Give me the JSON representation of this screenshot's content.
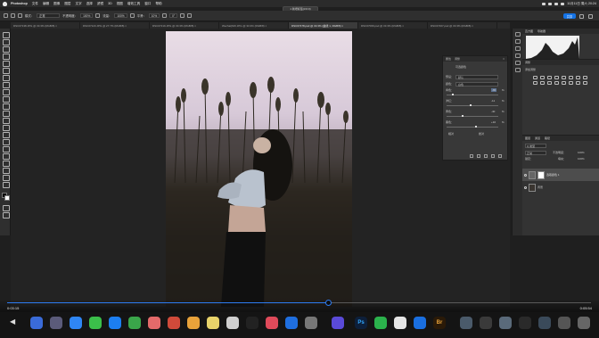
{
  "menubar": {
    "app": "Photoshop",
    "items": [
      "文件",
      "编辑",
      "图像",
      "图层",
      "文字",
      "选择",
      "滤镜",
      "3D",
      "视图",
      "增效工具",
      "窗口",
      "帮助"
    ],
    "clock": "11月11日 周六 20:24"
  },
  "window_title": "1 新增标签(3:0:0)",
  "options": {
    "mode_label": "模式：",
    "mode_value": "正常",
    "opacity_label": "不透明度：",
    "opacity_value": "100%",
    "flow_label": "流量：",
    "flow_value": "100%",
    "smooth_label": "平滑：",
    "smooth_value": "10%",
    "angle_value": "0°",
    "share": "共享"
  },
  "tabs": [
    {
      "label": "DSC07138.JPG @ 33.3% (RGB/8) × "
    },
    {
      "label": "DSC07123.JPG @ 27.7% (RGB/8) × "
    },
    {
      "label": "DSC07219.JPG @ 33.3% (RGB/8) × "
    },
    {
      "label": "Wechat(MO.JPG @ 33.3% (RGB/8) × "
    },
    {
      "label": "DSC07478.psd @ 33.3% (曲线 1, RGB/8) × ",
      "active": true
    },
    {
      "label": "DSC07069.psd @ 33.3% (RGB/8) × "
    },
    {
      "label": "DSC07467.psd @ 33.3% (RGB/8) × "
    }
  ],
  "properties": {
    "tab1": "属性",
    "tab2": "调整",
    "subtitle": "可选颜色",
    "preset_label": "预设：",
    "preset_value": "默认",
    "colors_label": "颜色：",
    "colors_value": "白色",
    "rows": [
      {
        "label": "青色：",
        "value": "-80",
        "unit": "%"
      },
      {
        "label": "洋红：",
        "value": "-11",
        "unit": "%"
      },
      {
        "label": "黄色：",
        "value": "-40",
        "unit": "%"
      },
      {
        "label": "黑色：",
        "value": "+10",
        "unit": "%"
      }
    ],
    "relative": "相对",
    "absolute": "绝对"
  },
  "histogram_panel": {
    "title": "直方图",
    "tab2": "导航器"
  },
  "adjust_panel": {
    "title": "调整",
    "tab2": "添加调整"
  },
  "layers_panel": {
    "tabs": [
      "图层",
      "通道",
      "路径"
    ],
    "kind_label": "Q 类型",
    "blend": "正常",
    "opacity_label": "不透明度：",
    "opacity_value": "100%",
    "lock_label": "锁定：",
    "fill_label": "填充：",
    "fill_value": "100%",
    "layers": [
      {
        "name": "选取颜色 1",
        "selected": true
      },
      {
        "name": "背景"
      }
    ]
  },
  "video": {
    "elapsed": "0:03:15",
    "remaining": "0:05:54",
    "progress": 0.55
  },
  "dock": {
    "ps_label": "Ps",
    "br_label": "Br"
  },
  "colors": {
    "accent": "#1473e6",
    "progress": "#2d7cf2"
  }
}
